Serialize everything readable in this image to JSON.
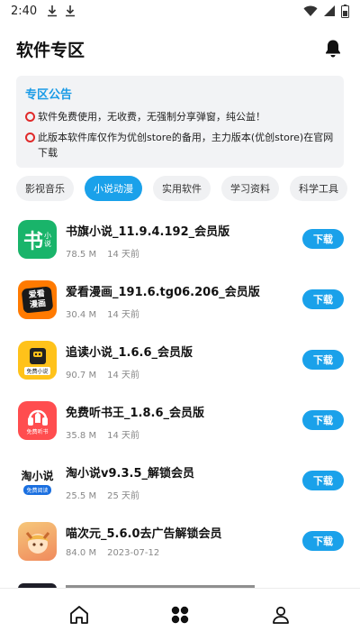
{
  "status_bar": {
    "time": "2:40"
  },
  "header": {
    "title": "软件专区"
  },
  "notice": {
    "title": "专区公告",
    "line1": "软件免费使用，无收费，无强制分享弹窗，纯公益！",
    "line2": "此版本软件库仅作为优创store的备用，主力版本(优创store)在官网下载"
  },
  "tabs": [
    {
      "label": "影视音乐",
      "active": false
    },
    {
      "label": "小说动漫",
      "active": true
    },
    {
      "label": "实用软件",
      "active": false
    },
    {
      "label": "学习资料",
      "active": false
    },
    {
      "label": "科学工具",
      "active": false
    }
  ],
  "download_label": "下载",
  "apps": [
    {
      "name": "书旗小说_11.9.4.192_会员版",
      "size": "78.5 M",
      "date": "14 天前",
      "icon": "shuqi-icon"
    },
    {
      "name": "爱看漫画_191.6.tg06.206_会员版",
      "size": "30.4 M",
      "date": "14 天前",
      "icon": "aikan-icon"
    },
    {
      "name": "追读小说_1.6.6_会员版",
      "size": "90.7 M",
      "date": "14 天前",
      "icon": "zhuidu-icon"
    },
    {
      "name": "免费听书王_1.8.6_会员版",
      "size": "35.8 M",
      "date": "14 天前",
      "icon": "tingshu-icon"
    },
    {
      "name": "淘小说v9.3.5_解锁会员",
      "size": "25.5 M",
      "date": "25 天前",
      "icon": "taoxiaoshuo-icon"
    },
    {
      "name": "喵次元_5.6.0去广告解锁会员",
      "size": "84.0 M",
      "date": "2023-07-12",
      "icon": "miaociyuan-icon"
    }
  ],
  "icon_texts": {
    "shuqi_big": "书",
    "shuqi_small_1": "小",
    "shuqi_small_2": "说",
    "aikan_1": "爱看",
    "aikan_2": "漫画",
    "zhuidu": "免费小说",
    "tingshu": "免费听书",
    "tao_1": "淘小说",
    "tao_2": "免费阅读"
  },
  "colors": {
    "accent": "#1aa1ea",
    "notice_title": "#1a9be6",
    "notice_bg": "#f2f3f5"
  },
  "bottom_nav": [
    "home-icon",
    "apps-grid-icon",
    "profile-icon"
  ]
}
